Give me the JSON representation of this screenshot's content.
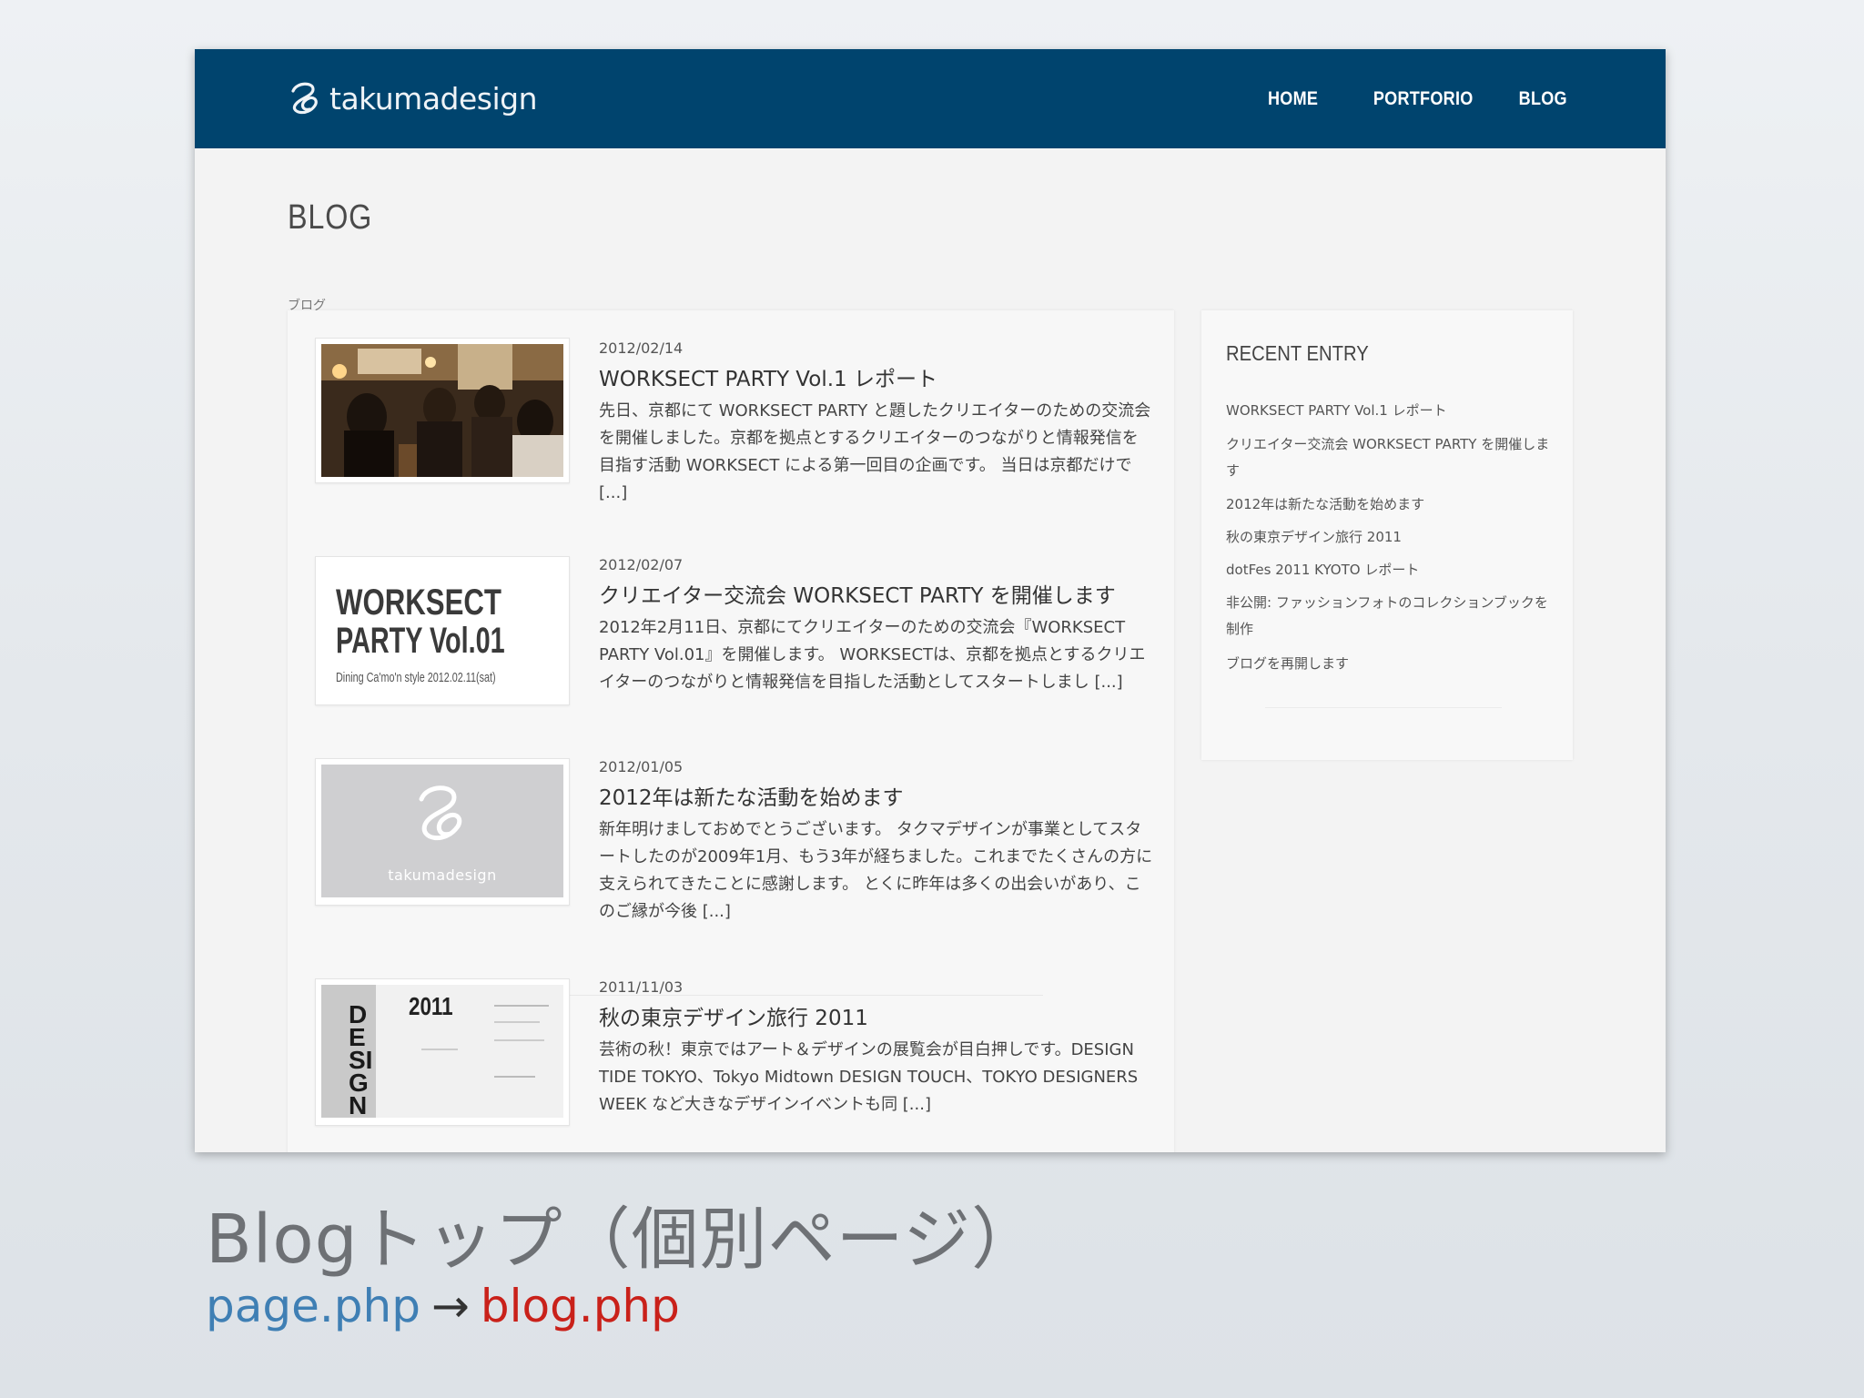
{
  "site": {
    "brand": "takumadesign",
    "colors": {
      "header_bg": "#00446e",
      "caption_from": "#3f7fb4",
      "caption_to": "#c9211a"
    },
    "nav": [
      {
        "label": "HOME"
      },
      {
        "label": "PORTFORIO"
      },
      {
        "label": "BLOG"
      }
    ]
  },
  "page": {
    "heading": "BLOG",
    "subheading": "ブログ"
  },
  "posts": [
    {
      "date": "2012/02/14",
      "title": "WORKSECT PARTY Vol.1 レポート",
      "excerpt": "先日、京都にて WORKSECT PARTY と題したクリエイターのための交流会を開催しました。京都を拠点とするクリエイターのつながりと情報発信を目指す活動 WORKSECT による第一回目の企画です。 当日は京都だけで [...]",
      "thumb": "party-photo"
    },
    {
      "date": "2012/02/07",
      "title": "クリエイター交流会 WORKSECT PARTY を開催します",
      "excerpt": "2012年2月11日、京都にてクリエイターのための交流会『WORKSECT PARTY Vol.01』を開催します。 WORKSECTは、京都を拠点とするクリエイターのつながりと情報発信を目指した活動としてスタートしまし [...]",
      "thumb": "event-flyer",
      "thumb_text": {
        "line1": "WORKSECT",
        "line2": "PARTY Vol.01",
        "line3": "Dining Ca'mo'n style  2012.02.11(sat)"
      }
    },
    {
      "date": "2012/01/05",
      "title": "2012年は新たな活動を始めます",
      "excerpt": "新年明けましておめでとうございます。 タクマデザインが事業としてスタートしたのが2009年1月、もう3年が経ちました。これまでたくさんの方に支えられてきたことに感謝します。 とくに昨年は多くの出会いがあり、このご縁が今後 [...]",
      "thumb": "logo-placeholder",
      "thumb_text": {
        "brand": "takumadesign"
      }
    },
    {
      "date": "2011/11/03",
      "title": "秋の東京デザイン旅行 2011",
      "excerpt": "芸術の秋！東京ではアート＆デザインの展覧会が目白押しです。DESIGN TIDE TOKYO、Tokyo Midtown DESIGN TOUCH、TOKYO DESIGNERS WEEK など大きなデザインイベントも同 [...]",
      "thumb": "exhibition-poster",
      "thumb_text": {
        "year": "2011",
        "vertical": "DESIGN TIDE"
      }
    }
  ],
  "sidebar": {
    "title": "RECENT ENTRY",
    "items": [
      "WORKSECT PARTY Vol.1 レポート",
      "クリエイター交流会 WORKSECT PARTY を開催します",
      "2012年は新たな活動を始めます",
      "秋の東京デザイン旅行 2011",
      "dotFes 2011 KYOTO レポート",
      "非公開: ファッションフォトのコレクションブックを制作",
      "ブログを再開します"
    ]
  },
  "slide": {
    "caption": "Blogトップ（個別ページ）",
    "file_from": "page.php",
    "arrow": "→",
    "file_to": "blog.php"
  }
}
